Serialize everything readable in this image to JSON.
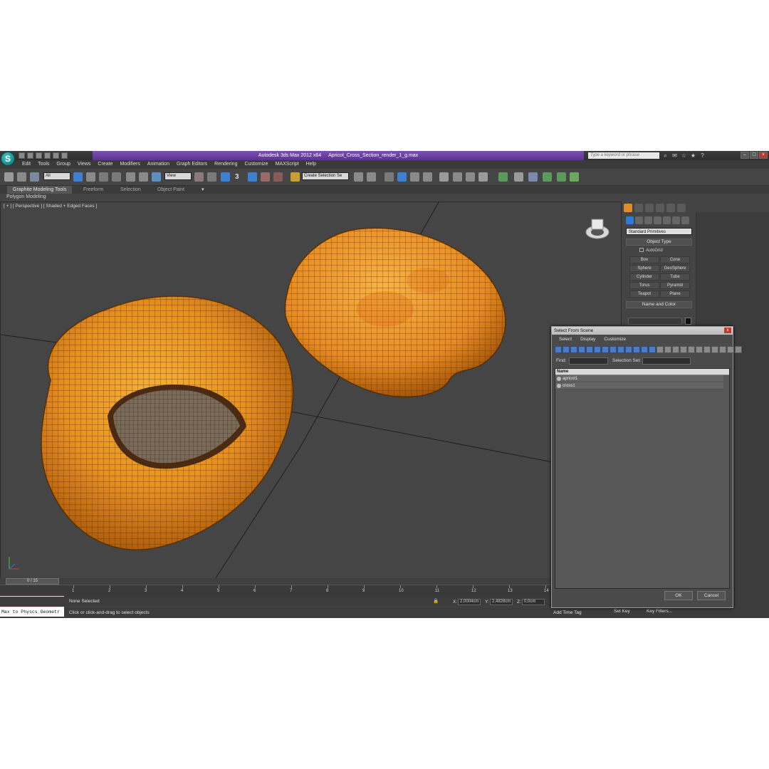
{
  "app": {
    "title_app": "Autodesk 3ds Max  2012 x64",
    "title_file": "Apricot_Cross_Section_render_1_g.max",
    "search_placeholder": "Type a keyword or phrase",
    "logo_glyph": "S"
  },
  "menu": [
    "Edit",
    "Tools",
    "Group",
    "Views",
    "Create",
    "Modifiers",
    "Animation",
    "Graph Editors",
    "Rendering",
    "Customize",
    "MAXScript",
    "Help"
  ],
  "toolbar": {
    "filter_value": "All",
    "ref_coord_value": "View",
    "selection_set_value": "Create Selection Se",
    "snap_label": "3"
  },
  "ribbon": {
    "tabs": [
      "Graphite Modeling Tools",
      "Freeform",
      "Selection",
      "Object Paint"
    ],
    "sub_label": "Polygon Modeling"
  },
  "viewport": {
    "label": "[ + ] [ Perspective ] [ Shaded + Edged Faces ]",
    "colors": {
      "apricot": "#e8901a",
      "pit": "#7a6a58",
      "wire": "#3a2a10"
    }
  },
  "command_panel": {
    "dropdown_value": "Standard Primitives",
    "object_type_label": "Object Type",
    "autogrid_label": "AutoGrid",
    "primitives": [
      "Box",
      "Cone",
      "Sphere",
      "GeoSphere",
      "Cylinder",
      "Tube",
      "Torus",
      "Pyramid",
      "Teapot",
      "Plane"
    ],
    "name_color_label": "Name and Color"
  },
  "dialog": {
    "title": "Select From Scene",
    "close_glyph": "x",
    "menu": [
      "Select",
      "Display",
      "Customize"
    ],
    "find_label": "Find:",
    "selection_set_label": "Selection Set:",
    "column_name": "Name",
    "items": [
      "apricot1",
      "cross1"
    ],
    "ok_label": "OK",
    "cancel_label": "Cancel"
  },
  "timeline": {
    "frame_label": "0 / 15",
    "ticks": [
      "1",
      "2",
      "3",
      "4",
      "5",
      "6",
      "7",
      "8",
      "9",
      "10",
      "11",
      "12",
      "13",
      "14"
    ]
  },
  "status": {
    "maxscript_text": "Max to Physcs Geometr",
    "selection": "None Selected",
    "prompt": "Click or click-and-drag to select objects",
    "x_label": "X:",
    "x_value": "2,0004cm",
    "y_label": "Y:",
    "y_value": "2,4828cm",
    "z_label": "Z:",
    "z_value": "0,0cm",
    "add_time_tag": "Add Time Tag",
    "set_key": "Set Key",
    "key_filters": "Key Filters..."
  }
}
